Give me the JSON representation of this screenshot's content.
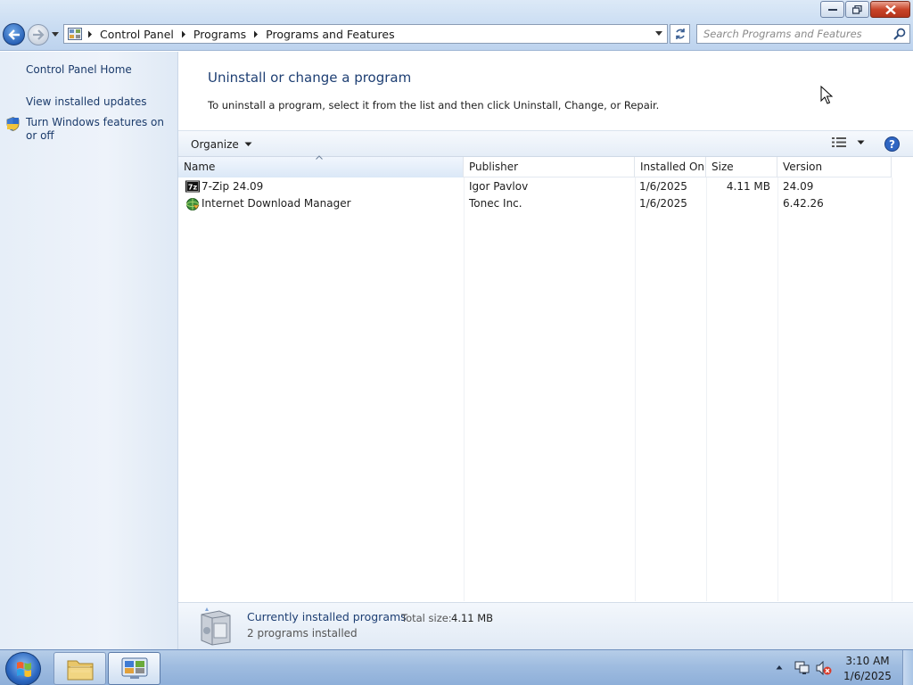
{
  "window": {
    "controls": {
      "minimize_icon": "minimize-icon",
      "restore_icon": "restore-icon",
      "close_icon": "close-icon"
    }
  },
  "address_bar": {
    "breadcrumbs": [
      "Control Panel",
      "Programs",
      "Programs and Features"
    ],
    "search_placeholder": "Search Programs and Features"
  },
  "sidebar": {
    "links": [
      {
        "label": "Control Panel Home"
      },
      {
        "label": "View installed updates"
      },
      {
        "label": "Turn Windows features on or off",
        "icon": "shield-icon"
      }
    ]
  },
  "main": {
    "title": "Uninstall or change a program",
    "description": "To uninstall a program, select it from the list and then click Uninstall, Change, or Repair."
  },
  "toolbar": {
    "organize_label": "Organize"
  },
  "table": {
    "columns": [
      "Name",
      "Publisher",
      "Installed On",
      "Size",
      "Version"
    ],
    "sorted_column": "Name",
    "rows": [
      {
        "name": "7-Zip 24.09",
        "publisher": "Igor Pavlov",
        "installed_on": "1/6/2025",
        "size": "4.11 MB",
        "version": "24.09",
        "icon": "7zip-icon"
      },
      {
        "name": "Internet Download Manager",
        "publisher": "Tonec Inc.",
        "installed_on": "1/6/2025",
        "size": "",
        "version": "6.42.26",
        "icon": "idm-icon"
      }
    ]
  },
  "status": {
    "title": "Currently installed programs",
    "total_size_label": "Total size:",
    "total_size_value": "4.11 MB",
    "count_text": "2 programs installed"
  },
  "taskbar": {
    "time": "3:10 AM",
    "date": "1/6/2025"
  },
  "colors": {
    "title_blue": "#1e3f73",
    "link_blue": "#1b3b6b",
    "close_red": "#c9452a"
  }
}
